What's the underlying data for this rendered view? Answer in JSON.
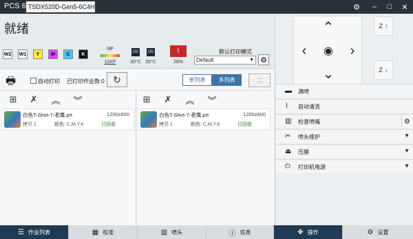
{
  "titlebar": {
    "app_name": "PCS 6",
    "device_tab": "TSDX520D-Gen5-6C4H",
    "settings_icon": "gear-icon",
    "minimize_icon": "minimize-icon",
    "maximize_icon": "maximize-icon",
    "close_icon": "close-icon"
  },
  "status": {
    "title": "就绪",
    "inks": [
      {
        "label": "W2",
        "color": "#ffffff"
      },
      {
        "label": "W1",
        "color": "#ffffff"
      },
      {
        "label": "Y",
        "color": "#ffeb3b"
      },
      {
        "label": "M",
        "color": "#e040fb"
      },
      {
        "label": "C",
        "color": "#4fc3f7"
      },
      {
        "label": "K",
        "color": "#111111"
      }
    ],
    "np_label": "NP",
    "np_value": "11KP",
    "uv_label": "UV",
    "uv1_temp": "30°C",
    "uv2_temp": "35°C",
    "heat_value": "26%",
    "mode_label": "默认打印模式",
    "mode_value": "Default"
  },
  "jobbar": {
    "auto_print": "自动打印",
    "printed_count": "已打印作业数:0",
    "single_list": "单列表",
    "multi_list": "多列表"
  },
  "lists": [
    {
      "job": {
        "name": "白色T-Shirt-7-老鹰.prt",
        "size": "1200x600",
        "copies": "拷贝:1",
        "colors": "颜色: C,M,Y,K",
        "status": "已回收"
      }
    },
    {
      "job": {
        "name": "白色T-Shirt-7-老鹰.prt",
        "size": "1200x600",
        "copies": "拷贝:1",
        "colors": "颜色: C,M,Y,K",
        "status": "已回收"
      }
    }
  ],
  "bottom_tabs": [
    {
      "label": "作业列表",
      "icon": "list-icon"
    },
    {
      "label": "校准",
      "icon": "calibrate-icon"
    },
    {
      "label": "喷头",
      "icon": "nozzle-icon"
    },
    {
      "label": "信息",
      "icon": "info-icon"
    },
    {
      "label": "操作",
      "icon": "move-icon"
    },
    {
      "label": "设置",
      "icon": "gear-icon"
    }
  ],
  "right": {
    "z_up": "Z",
    "z_down": "Z",
    "menu": [
      {
        "label": "满喷",
        "icon": "print-icon"
      },
      {
        "label": "自动清洗",
        "icon": "clean-icon"
      },
      {
        "label": "检查喷嘴",
        "icon": "nozzle-check-icon"
      },
      {
        "label": "喷头维护",
        "icon": "maintenance-icon"
      },
      {
        "label": "压膜",
        "icon": "press-icon"
      },
      {
        "label": "打印机电源",
        "icon": "power-icon"
      }
    ]
  },
  "colors": {
    "accent": "#3f74a8",
    "active_tab": "#1f3b54",
    "titlebar": "#2b3138"
  }
}
